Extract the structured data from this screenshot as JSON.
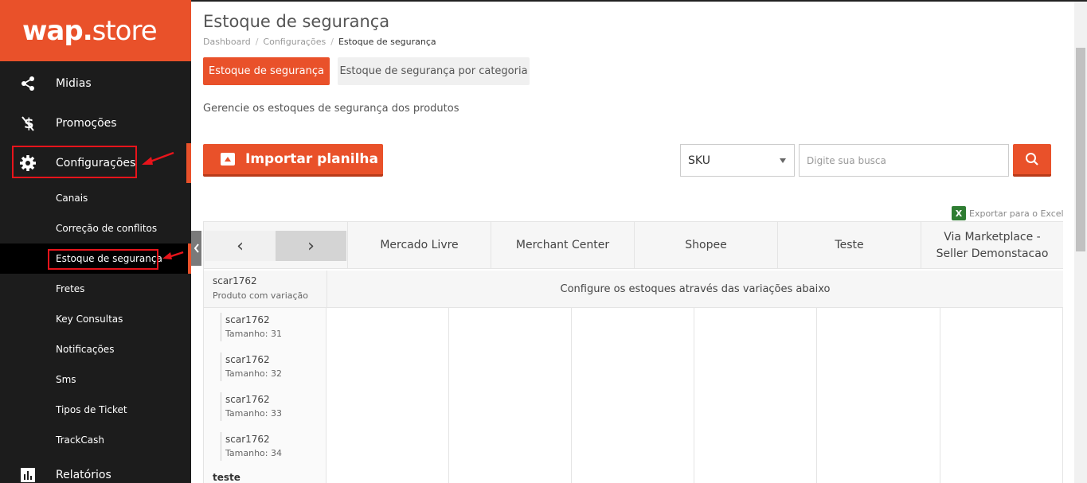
{
  "brand": {
    "logo_wap": "wap",
    "logo_dot": ".",
    "logo_store": "store",
    "accent_color": "#e9512a"
  },
  "sidebar": {
    "items": [
      {
        "label": "Midias",
        "icon": "share-icon"
      },
      {
        "label": "Promoções",
        "icon": "dollar-icon"
      },
      {
        "label": "Configurações",
        "icon": "gear-icon"
      },
      {
        "label": "Relatórios",
        "icon": "bar-chart-icon"
      }
    ],
    "sub_items": [
      {
        "label": "Canais"
      },
      {
        "label": "Correção de conflitos"
      },
      {
        "label": "Estoque de segurança"
      },
      {
        "label": "Fretes"
      },
      {
        "label": "Key Consultas"
      },
      {
        "label": "Notificações"
      },
      {
        "label": "Sms"
      },
      {
        "label": "Tipos de Ticket"
      },
      {
        "label": "TrackCash"
      }
    ]
  },
  "page": {
    "title": "Estoque de segurança",
    "breadcrumb": [
      "Dashboard",
      "Configurações",
      "Estoque de segurança"
    ],
    "breadcrumb_sep": "/",
    "tabs": [
      {
        "label": "Estoque de segurança",
        "active": true
      },
      {
        "label": "Estoque de segurança por categoria",
        "active": false
      }
    ],
    "description": "Gerencie os estoques de segurança dos produtos"
  },
  "toolbar": {
    "import_label": "Importar planilha",
    "filter_selected": "SKU",
    "search_placeholder": "Digite sua busca",
    "export_label": "Exportar para o Excel",
    "excel_letter": "X"
  },
  "table": {
    "nav_prev": "‹",
    "nav_next": "›",
    "columns": [
      "Mercado Livre",
      "Merchant Center",
      "Shopee",
      "Teste",
      "Via Marketplace - Seller Demonstacao"
    ],
    "product": {
      "sku": "scar1762",
      "desc": "Produto com variação",
      "message": "Configure os estoques através das variações abaixo"
    },
    "variations": [
      {
        "sku": "scar1762",
        "size": "Tamanho: 31"
      },
      {
        "sku": "scar1762",
        "size": "Tamanho: 32"
      },
      {
        "sku": "scar1762",
        "size": "Tamanho: 33"
      },
      {
        "sku": "scar1762",
        "size": "Tamanho: 34"
      }
    ],
    "next_product": "teste"
  }
}
